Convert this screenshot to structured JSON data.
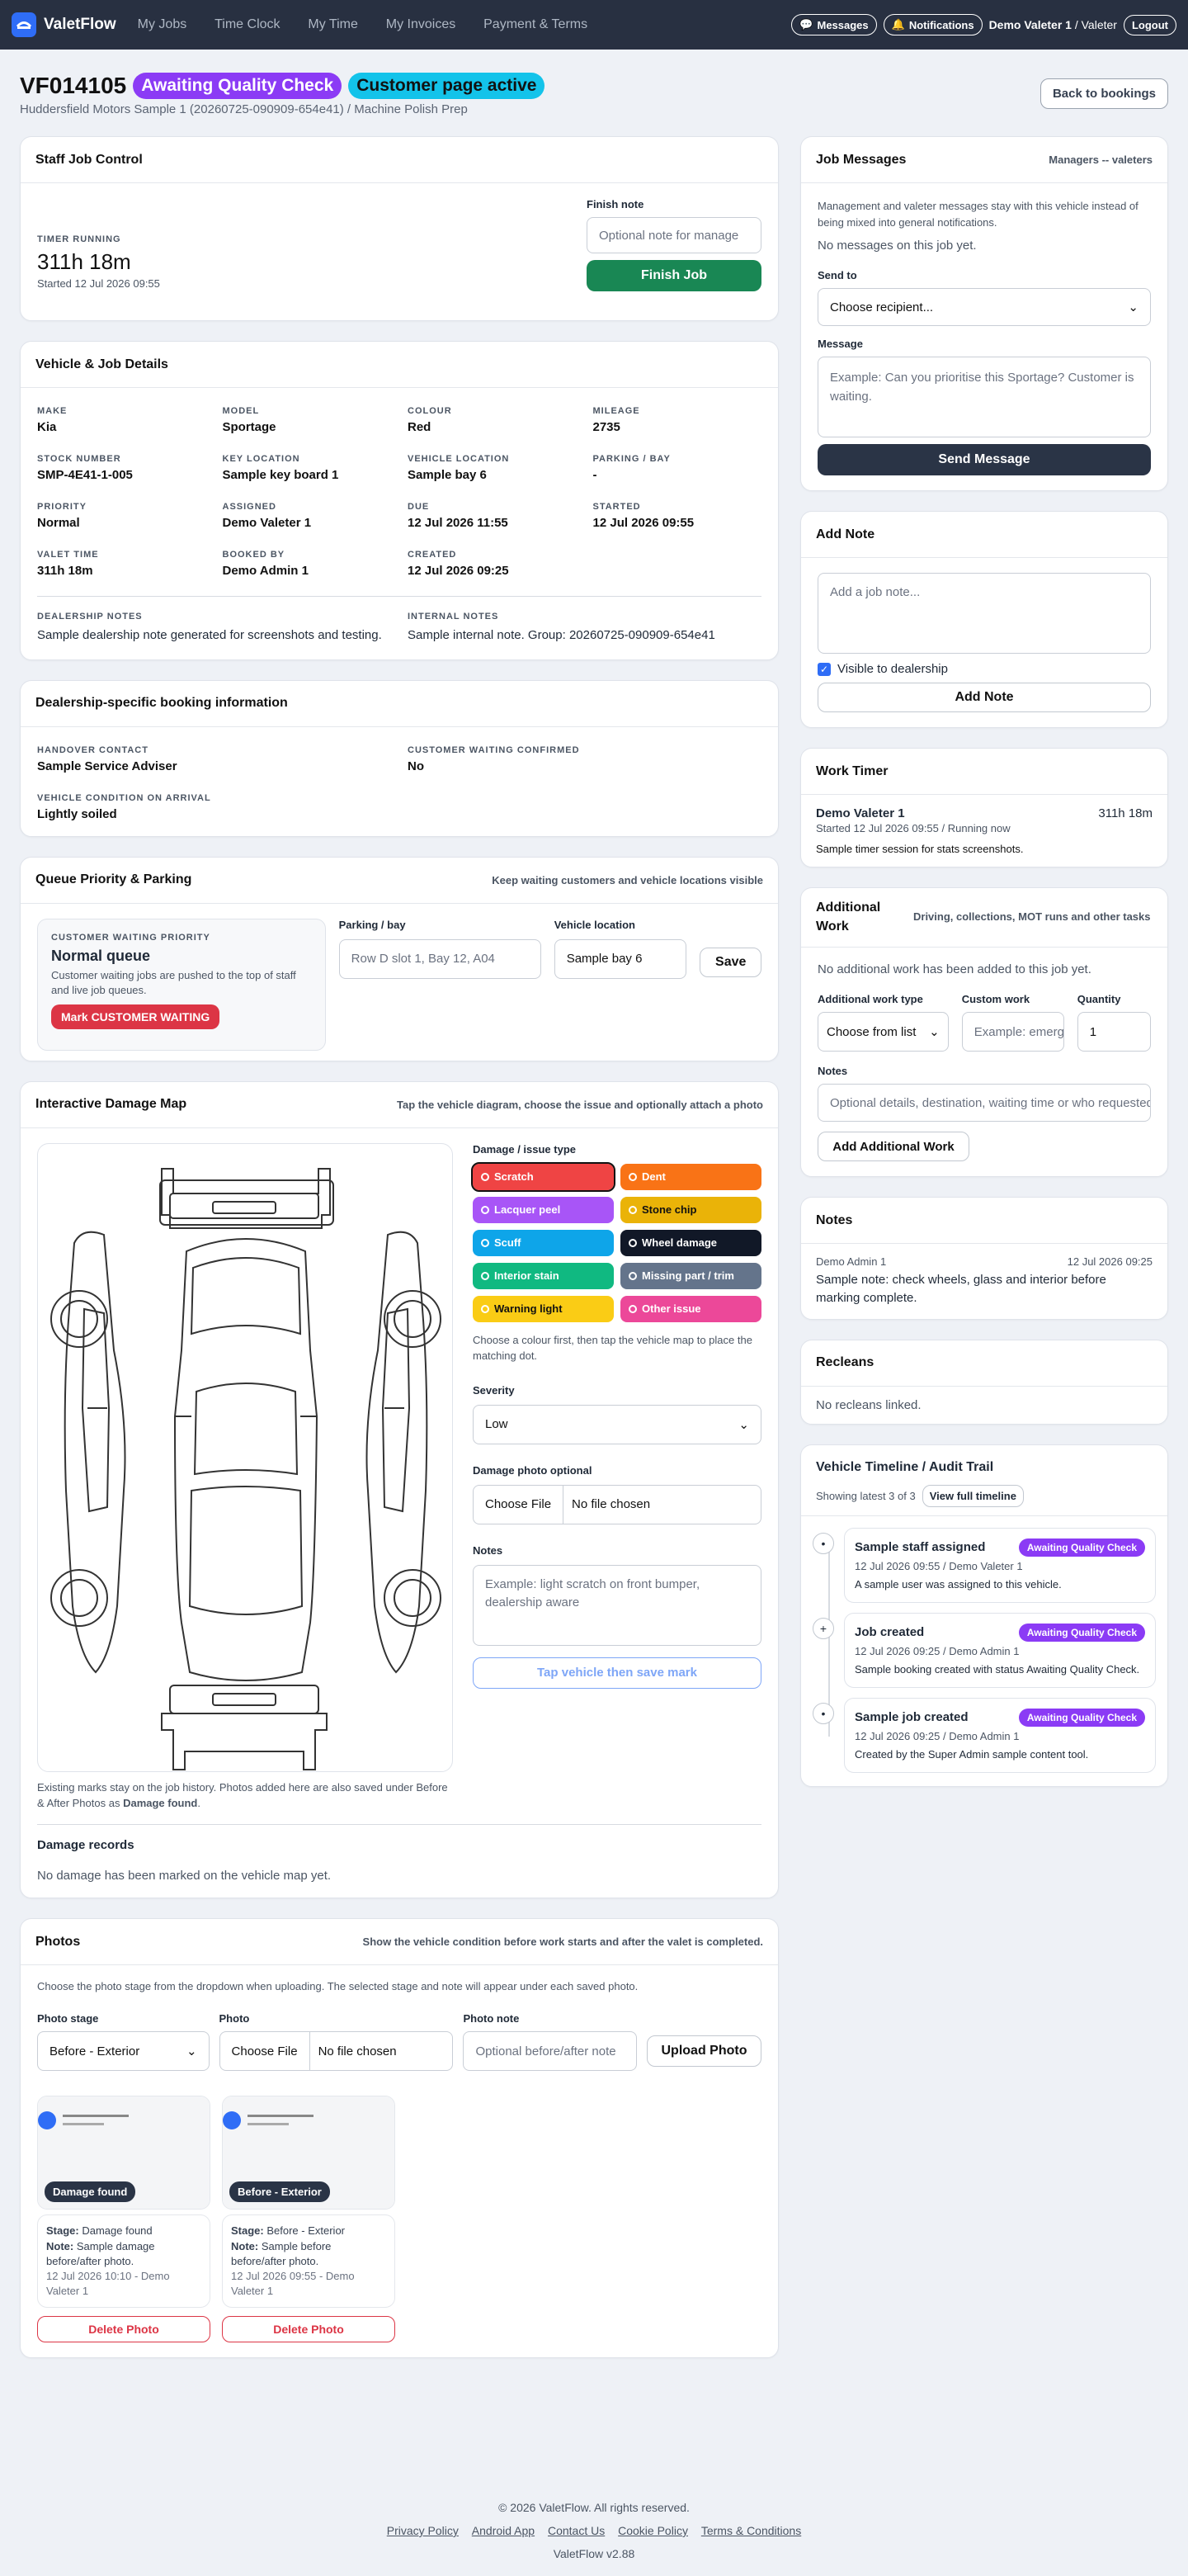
{
  "nav": {
    "brand": "ValetFlow",
    "links": [
      "My Jobs",
      "Time Clock",
      "My Time",
      "My Invoices",
      "Payment & Terms"
    ],
    "messages": "Messages",
    "notifications": "Notifications",
    "user_name": "Demo Valeter 1",
    "user_role": "/ Valeter",
    "logout": "Logout"
  },
  "job": {
    "id": "VF014105",
    "status": "Awaiting Quality Check",
    "page_status": "Customer page active",
    "subtitle": "Huddersfield Motors Sample 1 (20260725-090909-654e41) / Machine Polish Prep",
    "back": "Back to bookings"
  },
  "control": {
    "title": "Staff Job Control",
    "timer_label": "TIMER RUNNING",
    "timer": "311h 18m",
    "started": "Started 12 Jul 2026 09:55",
    "finish_note_label": "Finish note",
    "finish_note_placeholder": "Optional note for manage",
    "finish": "Finish Job"
  },
  "details": {
    "title": "Vehicle & Job Details",
    "fields": [
      {
        "label": "MAKE",
        "value": "Kia"
      },
      {
        "label": "MODEL",
        "value": "Sportage"
      },
      {
        "label": "COLOUR",
        "value": "Red"
      },
      {
        "label": "MILEAGE",
        "value": "2735"
      },
      {
        "label": "STOCK NUMBER",
        "value": "SMP-4E41-1-005"
      },
      {
        "label": "KEY LOCATION",
        "value": "Sample key board 1"
      },
      {
        "label": "VEHICLE LOCATION",
        "value": "Sample bay 6"
      },
      {
        "label": "PARKING / BAY",
        "value": "-"
      },
      {
        "label": "PRIORITY",
        "value": "Normal"
      },
      {
        "label": "ASSIGNED",
        "value": "Demo Valeter 1"
      },
      {
        "label": "DUE",
        "value": "12 Jul 2026 11:55"
      },
      {
        "label": "STARTED",
        "value": "12 Jul 2026 09:55"
      },
      {
        "label": "VALET TIME",
        "value": "311h 18m"
      },
      {
        "label": "BOOKED BY",
        "value": "Demo Admin 1"
      },
      {
        "label": "CREATED",
        "value": "12 Jul 2026 09:25"
      }
    ],
    "dealer_notes_label": "DEALERSHIP NOTES",
    "dealer_notes": "Sample dealership note generated for screenshots and testing.",
    "internal_notes_label": "INTERNAL NOTES",
    "internal_notes": "Sample internal note. Group: 20260725-090909-654e41"
  },
  "dealer": {
    "title": "Dealership-specific booking information",
    "fields": [
      {
        "label": "HANDOVER CONTACT",
        "value": "Sample Service Adviser"
      },
      {
        "label": "CUSTOMER WAITING CONFIRMED",
        "value": "No"
      },
      {
        "label": "VEHICLE CONDITION ON ARRIVAL",
        "value": "Lightly soiled"
      }
    ]
  },
  "queue": {
    "title": "Queue Priority & Parking",
    "hint": "Keep waiting customers and vehicle locations visible",
    "priority_label": "CUSTOMER WAITING PRIORITY",
    "priority_value": "Normal queue",
    "priority_desc": "Customer waiting jobs are pushed to the top of staff and live job queues.",
    "mark": "Mark CUSTOMER WAITING",
    "parking_label": "Parking / bay",
    "parking_placeholder": "Row D slot 1, Bay 12, A04",
    "location_label": "Vehicle location",
    "location_value": "Sample bay 6",
    "save": "Save"
  },
  "damage": {
    "title": "Interactive Damage Map",
    "hint": "Tap the vehicle diagram, choose the issue and optionally attach a photo",
    "type_label": "Damage / issue type",
    "types": [
      {
        "name": "Scratch",
        "color": "#ef4444"
      },
      {
        "name": "Dent",
        "color": "#f97316"
      },
      {
        "name": "Lacquer peel",
        "color": "#a855f7"
      },
      {
        "name": "Stone chip",
        "color": "#eab308"
      },
      {
        "name": "Scuff",
        "color": "#0ea5e9"
      },
      {
        "name": "Wheel damage",
        "color": "#111827"
      },
      {
        "name": "Interior stain",
        "color": "#10b981"
      },
      {
        "name": "Missing part / trim",
        "color": "#64748b"
      },
      {
        "name": "Warning light",
        "color": "#facc15"
      },
      {
        "name": "Other issue",
        "color": "#ec4899"
      }
    ],
    "type_help": "Choose a colour first, then tap the vehicle map to place the matching dot.",
    "severity_label": "Severity",
    "severity": "Low",
    "photo_label": "Damage photo optional",
    "choose_file": "Choose File",
    "no_file": "No file chosen",
    "notes_label": "Notes",
    "notes_placeholder": "Example: light scratch on front bumper, dealership aware",
    "save_mark": "Tap vehicle then save mark",
    "history_note_1": "Existing marks stay on the job history. Photos added here are also saved under Before & After Photos as",
    "history_note_bold": "Damage found",
    "history_note_end": ".",
    "records_title": "Damage records",
    "records_empty": "No damage has been marked on the vehicle map yet."
  },
  "photos": {
    "title": "Photos",
    "hint": "Show the vehicle condition before work starts and after the valet is completed.",
    "desc": "Choose the photo stage from the dropdown when uploading. The selected stage and note will appear under each saved photo.",
    "stage_label": "Photo stage",
    "stage_value": "Before - Exterior",
    "photo_label": "Photo",
    "choose_file": "Choose File",
    "no_file": "No file chosen",
    "note_label": "Photo note",
    "note_placeholder": "Optional before/after note",
    "upload": "Upload Photo",
    "items": [
      {
        "badge": "Damage found",
        "stage_label": "Stage:",
        "stage": "Damage found",
        "note_label": "Note:",
        "note": "Sample damage before/after photo.",
        "meta": "12 Jul 2026 10:10 - Demo Valeter 1",
        "delete": "Delete Photo"
      },
      {
        "badge": "Before - Exterior",
        "stage_label": "Stage:",
        "stage": "Before - Exterior",
        "note_label": "Note:",
        "note": "Sample before before/after photo.",
        "meta": "12 Jul 2026 09:55 - Demo Valeter 1",
        "delete": "Delete Photo"
      }
    ]
  },
  "messages": {
    "title": "Job Messages",
    "hint": "Managers -- valeters",
    "desc": "Management and valeter messages stay with this vehicle instead of being mixed into general notifications.",
    "empty": "No messages on this job yet.",
    "send_to_label": "Send to",
    "send_to": "Choose recipient...",
    "message_label": "Message",
    "message_placeholder": "Example: Can you prioritise this Sportage? Customer is waiting.",
    "send": "Send Message"
  },
  "add_note": {
    "title": "Add Note",
    "placeholder": "Add a job note...",
    "visible": "Visible to dealership",
    "button": "Add Note"
  },
  "work_timer": {
    "title": "Work Timer",
    "name": "Demo Valeter 1",
    "time": "311h 18m",
    "meta": "Started 12 Jul 2026 09:55 / Running now",
    "desc": "Sample timer session for stats screenshots."
  },
  "additional": {
    "title": "Additional Work",
    "hint": "Driving, collections, MOT runs and other tasks",
    "empty": "No additional work has been added to this job yet.",
    "type_label": "Additional work type",
    "type_value": "Choose from list",
    "custom_label": "Custom work",
    "custom_placeholder": "Example: emergency",
    "qty_label": "Quantity",
    "qty": "1",
    "notes_label": "Notes",
    "notes_placeholder": "Optional details, destination, waiting time or who requested it",
    "button": "Add Additional Work"
  },
  "notes": {
    "title": "Notes",
    "author": "Demo Admin 1",
    "date": "12 Jul 2026 09:25",
    "text": "Sample note: check wheels, glass and interior before marking complete."
  },
  "recleans": {
    "title": "Recleans",
    "empty": "No recleans linked."
  },
  "timeline": {
    "title": "Vehicle Timeline / Audit Trail",
    "showing": "Showing latest 3 of 3",
    "view_all": "View full timeline",
    "items": [
      {
        "icon": "•",
        "title": "Sample staff assigned",
        "badge": "Awaiting Quality Check",
        "meta": "12 Jul 2026 09:55 / Demo Valeter 1",
        "desc": "A sample user was assigned to this vehicle."
      },
      {
        "icon": "+",
        "title": "Job created",
        "badge": "Awaiting Quality Check",
        "meta": "12 Jul 2026 09:25 / Demo Admin 1",
        "desc": "Sample booking created with status Awaiting Quality Check."
      },
      {
        "icon": "•",
        "title": "Sample job created",
        "badge": "Awaiting Quality Check",
        "meta": "12 Jul 2026 09:25 / Demo Admin 1",
        "desc": "Created by the Super Admin sample content tool."
      }
    ]
  },
  "footer": {
    "copyright": "© 2026 ValetFlow. All rights reserved.",
    "links": [
      "Privacy Policy",
      "Android App",
      "Contact Us",
      "Cookie Policy",
      "Terms & Conditions"
    ],
    "version": "ValetFlow v2.88"
  }
}
